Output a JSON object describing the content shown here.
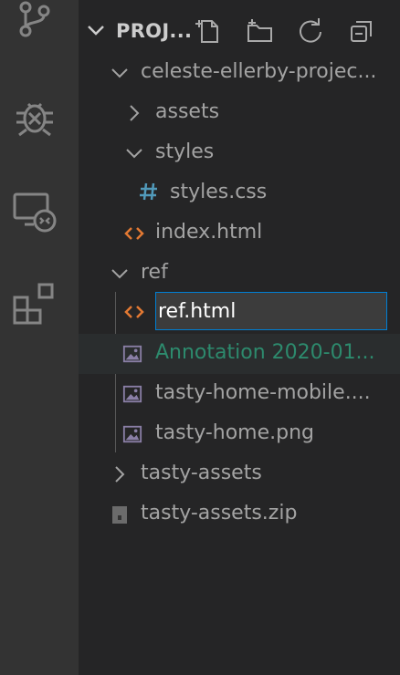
{
  "activity_bar": {
    "icons": [
      "source-control-icon",
      "debug-icon",
      "remote-explorer-icon",
      "extensions-icon"
    ]
  },
  "explorer": {
    "section_title": "PROJ...",
    "actions": [
      "new-file-icon",
      "new-folder-icon",
      "refresh-icon",
      "collapse-all-icon"
    ],
    "tree": {
      "project_folder": "celeste-ellerby-projec...",
      "assets": "assets",
      "styles": "styles",
      "styles_css": "styles.css",
      "index_html": "index.html",
      "ref": "ref",
      "rename_value": "ref.html",
      "annotation": "Annotation 2020-01...",
      "tasty_mobile": "tasty-home-mobile....",
      "tasty_home": "tasty-home.png",
      "tasty_assets": "tasty-assets",
      "tasty_zip": "tasty-assets.zip"
    }
  },
  "colors": {
    "activity_bg": "#333333",
    "sidebar_bg": "#252526",
    "text": "#a3a3a3",
    "html_icon": "#e37933",
    "css_icon": "#519aba",
    "untracked_green": "#2d8a6d",
    "focus_border": "#007fd4"
  }
}
